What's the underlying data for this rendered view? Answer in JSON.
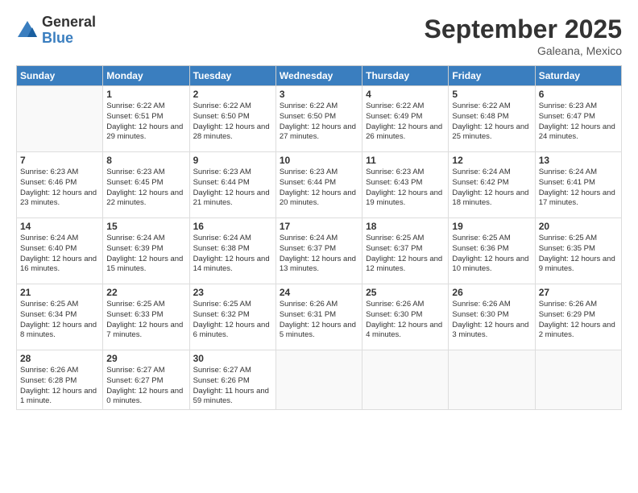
{
  "logo": {
    "general": "General",
    "blue": "Blue"
  },
  "title": "September 2025",
  "location": "Galeana, Mexico",
  "headers": [
    "Sunday",
    "Monday",
    "Tuesday",
    "Wednesday",
    "Thursday",
    "Friday",
    "Saturday"
  ],
  "weeks": [
    [
      {
        "day": "",
        "info": ""
      },
      {
        "day": "1",
        "info": "Sunrise: 6:22 AM\nSunset: 6:51 PM\nDaylight: 12 hours\nand 29 minutes."
      },
      {
        "day": "2",
        "info": "Sunrise: 6:22 AM\nSunset: 6:50 PM\nDaylight: 12 hours\nand 28 minutes."
      },
      {
        "day": "3",
        "info": "Sunrise: 6:22 AM\nSunset: 6:50 PM\nDaylight: 12 hours\nand 27 minutes."
      },
      {
        "day": "4",
        "info": "Sunrise: 6:22 AM\nSunset: 6:49 PM\nDaylight: 12 hours\nand 26 minutes."
      },
      {
        "day": "5",
        "info": "Sunrise: 6:22 AM\nSunset: 6:48 PM\nDaylight: 12 hours\nand 25 minutes."
      },
      {
        "day": "6",
        "info": "Sunrise: 6:23 AM\nSunset: 6:47 PM\nDaylight: 12 hours\nand 24 minutes."
      }
    ],
    [
      {
        "day": "7",
        "info": "Sunrise: 6:23 AM\nSunset: 6:46 PM\nDaylight: 12 hours\nand 23 minutes."
      },
      {
        "day": "8",
        "info": "Sunrise: 6:23 AM\nSunset: 6:45 PM\nDaylight: 12 hours\nand 22 minutes."
      },
      {
        "day": "9",
        "info": "Sunrise: 6:23 AM\nSunset: 6:44 PM\nDaylight: 12 hours\nand 21 minutes."
      },
      {
        "day": "10",
        "info": "Sunrise: 6:23 AM\nSunset: 6:44 PM\nDaylight: 12 hours\nand 20 minutes."
      },
      {
        "day": "11",
        "info": "Sunrise: 6:23 AM\nSunset: 6:43 PM\nDaylight: 12 hours\nand 19 minutes."
      },
      {
        "day": "12",
        "info": "Sunrise: 6:24 AM\nSunset: 6:42 PM\nDaylight: 12 hours\nand 18 minutes."
      },
      {
        "day": "13",
        "info": "Sunrise: 6:24 AM\nSunset: 6:41 PM\nDaylight: 12 hours\nand 17 minutes."
      }
    ],
    [
      {
        "day": "14",
        "info": "Sunrise: 6:24 AM\nSunset: 6:40 PM\nDaylight: 12 hours\nand 16 minutes."
      },
      {
        "day": "15",
        "info": "Sunrise: 6:24 AM\nSunset: 6:39 PM\nDaylight: 12 hours\nand 15 minutes."
      },
      {
        "day": "16",
        "info": "Sunrise: 6:24 AM\nSunset: 6:38 PM\nDaylight: 12 hours\nand 14 minutes."
      },
      {
        "day": "17",
        "info": "Sunrise: 6:24 AM\nSunset: 6:37 PM\nDaylight: 12 hours\nand 13 minutes."
      },
      {
        "day": "18",
        "info": "Sunrise: 6:25 AM\nSunset: 6:37 PM\nDaylight: 12 hours\nand 12 minutes."
      },
      {
        "day": "19",
        "info": "Sunrise: 6:25 AM\nSunset: 6:36 PM\nDaylight: 12 hours\nand 10 minutes."
      },
      {
        "day": "20",
        "info": "Sunrise: 6:25 AM\nSunset: 6:35 PM\nDaylight: 12 hours\nand 9 minutes."
      }
    ],
    [
      {
        "day": "21",
        "info": "Sunrise: 6:25 AM\nSunset: 6:34 PM\nDaylight: 12 hours\nand 8 minutes."
      },
      {
        "day": "22",
        "info": "Sunrise: 6:25 AM\nSunset: 6:33 PM\nDaylight: 12 hours\nand 7 minutes."
      },
      {
        "day": "23",
        "info": "Sunrise: 6:25 AM\nSunset: 6:32 PM\nDaylight: 12 hours\nand 6 minutes."
      },
      {
        "day": "24",
        "info": "Sunrise: 6:26 AM\nSunset: 6:31 PM\nDaylight: 12 hours\nand 5 minutes."
      },
      {
        "day": "25",
        "info": "Sunrise: 6:26 AM\nSunset: 6:30 PM\nDaylight: 12 hours\nand 4 minutes."
      },
      {
        "day": "26",
        "info": "Sunrise: 6:26 AM\nSunset: 6:30 PM\nDaylight: 12 hours\nand 3 minutes."
      },
      {
        "day": "27",
        "info": "Sunrise: 6:26 AM\nSunset: 6:29 PM\nDaylight: 12 hours\nand 2 minutes."
      }
    ],
    [
      {
        "day": "28",
        "info": "Sunrise: 6:26 AM\nSunset: 6:28 PM\nDaylight: 12 hours\nand 1 minute."
      },
      {
        "day": "29",
        "info": "Sunrise: 6:27 AM\nSunset: 6:27 PM\nDaylight: 12 hours\nand 0 minutes."
      },
      {
        "day": "30",
        "info": "Sunrise: 6:27 AM\nSunset: 6:26 PM\nDaylight: 11 hours\nand 59 minutes."
      },
      {
        "day": "",
        "info": ""
      },
      {
        "day": "",
        "info": ""
      },
      {
        "day": "",
        "info": ""
      },
      {
        "day": "",
        "info": ""
      }
    ]
  ]
}
